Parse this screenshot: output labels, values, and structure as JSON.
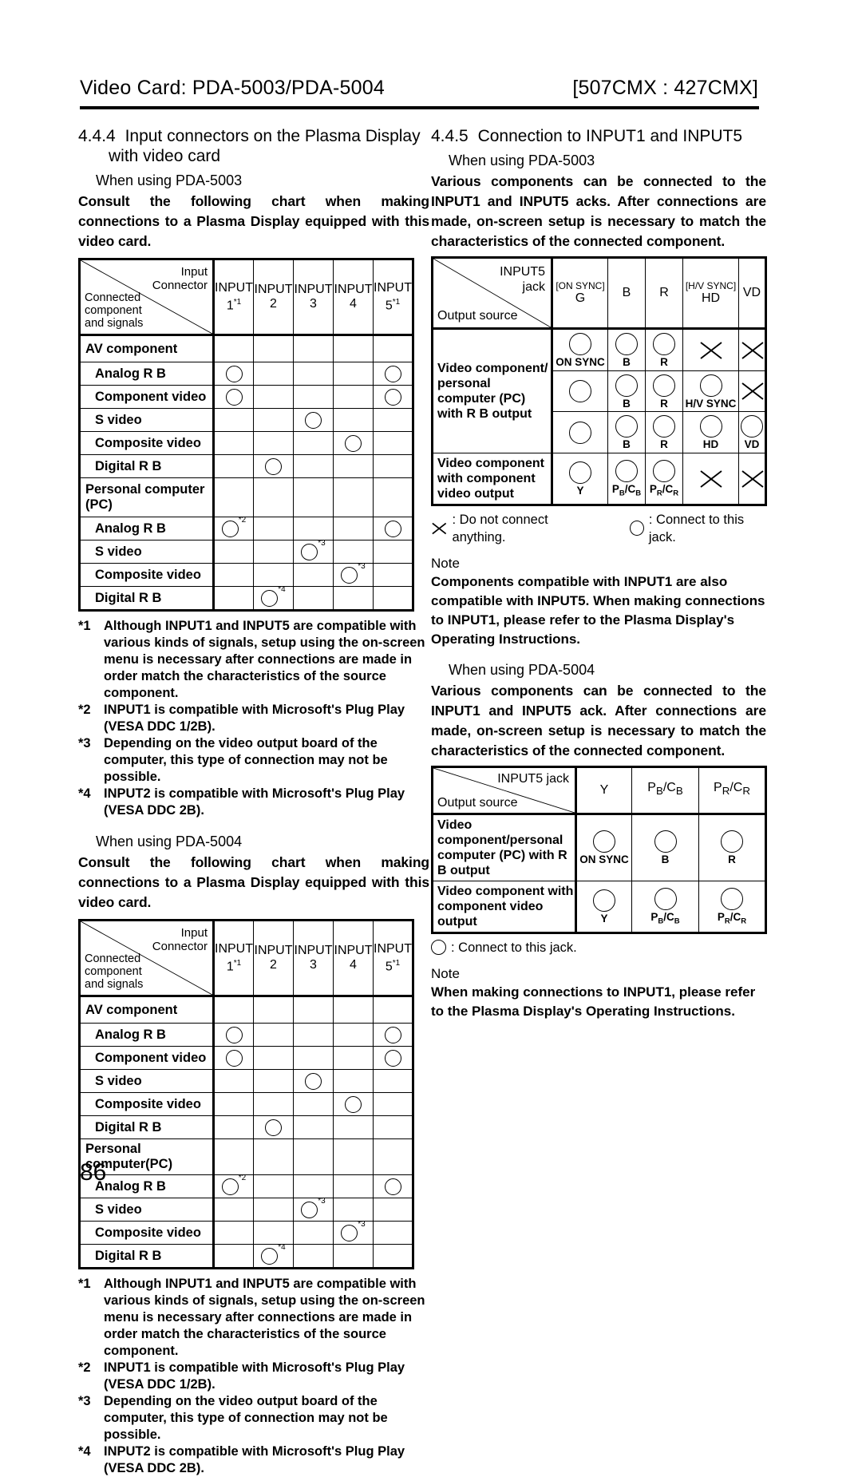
{
  "runhead": {
    "left": "Video Card: PDA-5003/PDA-5004",
    "right": "[507CMX : 427CMX]"
  },
  "page_number": "86",
  "left_column": {
    "section": {
      "number": "4.4.4",
      "title_line1": "Input connectors on the Plasma Display",
      "title_line2": "with video card"
    },
    "block_5003": {
      "subhead": "When using PDA-5003",
      "intro": "Consult the following chart when making connections to a Plasma Display equipped with this video card.",
      "table": {
        "corner_top_right": "Input\nConnector",
        "corner_bottom_left": "Connected\ncomponent\nand signals",
        "columns": [
          {
            "name": "INPUT",
            "num": "1",
            "note": "*1"
          },
          {
            "name": "INPUT",
            "num": "2",
            "note": ""
          },
          {
            "name": "INPUT",
            "num": "3",
            "note": ""
          },
          {
            "name": "INPUT",
            "num": "4",
            "note": ""
          },
          {
            "name": "INPUT",
            "num": "5",
            "note": "*1"
          }
        ],
        "rows": [
          {
            "type": "group",
            "label": "AV component",
            "marks": [
              "",
              "",
              "",
              "",
              ""
            ]
          },
          {
            "type": "sub",
            "label": "Analog R  B",
            "marks": [
              "o",
              "",
              "",
              "",
              "o"
            ]
          },
          {
            "type": "sub",
            "label": "Component video",
            "marks": [
              "o",
              "",
              "",
              "",
              "o"
            ]
          },
          {
            "type": "sub",
            "label": "S video",
            "marks": [
              "",
              "",
              "o",
              "",
              ""
            ]
          },
          {
            "type": "sub",
            "label": "Composite video",
            "marks": [
              "",
              "",
              "",
              "o",
              ""
            ]
          },
          {
            "type": "sub",
            "label": "Digital R  B",
            "marks": [
              "",
              "o",
              "",
              "",
              ""
            ]
          },
          {
            "type": "group",
            "label": "Personal computer\n(PC)",
            "marks": [
              "",
              "",
              "",
              "",
              ""
            ]
          },
          {
            "type": "sub",
            "label": "Analog R  B",
            "marks": [
              "o*2",
              "",
              "",
              "",
              "o"
            ]
          },
          {
            "type": "sub",
            "label": "S video",
            "marks": [
              "",
              "",
              "o*3",
              "",
              ""
            ]
          },
          {
            "type": "sub",
            "label": "Composite video",
            "marks": [
              "",
              "",
              "",
              "o*3",
              ""
            ]
          },
          {
            "type": "sub",
            "label": "Digital R  B",
            "marks": [
              "",
              "o*4",
              "",
              "",
              ""
            ]
          }
        ]
      },
      "footnotes": [
        {
          "key": "*1",
          "text": "Although INPUT1 and INPUT5 are compatible with various kinds of signals, setup using the on-screen menu is necessary after connections are made in order match the characteristics of the source component."
        },
        {
          "key": "*2",
          "text": "INPUT1 is compatible with Microsoft's Plug   Play (VESA DDC 1/2B)."
        },
        {
          "key": "*3",
          "text": "Depending on the video output board of the computer, this type of connection may not be possible."
        },
        {
          "key": "*4",
          "text": "INPUT2 is compatible with Microsoft's Plug   Play (VESA DDC 2B)."
        }
      ]
    },
    "block_5004": {
      "subhead": "When using PDA-5004",
      "intro": "Consult the following chart when making connections to a Plasma Display equipped with this video card.",
      "table": {
        "corner_top_right": "Input\nConnector",
        "corner_bottom_left": "Connected\ncomponent\nand signals",
        "columns": [
          {
            "name": "INPUT",
            "num": "1",
            "note": "*1"
          },
          {
            "name": "INPUT",
            "num": "2",
            "note": ""
          },
          {
            "name": "INPUT",
            "num": "3",
            "note": ""
          },
          {
            "name": "INPUT",
            "num": "4",
            "note": ""
          },
          {
            "name": "INPUT",
            "num": "5",
            "note": "*1"
          }
        ],
        "rows": [
          {
            "type": "group",
            "label": "AV component",
            "marks": [
              "",
              "",
              "",
              "",
              ""
            ]
          },
          {
            "type": "sub",
            "label": "Analog R  B",
            "marks": [
              "o",
              "",
              "",
              "",
              "o"
            ]
          },
          {
            "type": "sub",
            "label": "Component video",
            "marks": [
              "o",
              "",
              "",
              "",
              "o"
            ]
          },
          {
            "type": "sub",
            "label": "S video",
            "marks": [
              "",
              "",
              "o",
              "",
              ""
            ]
          },
          {
            "type": "sub",
            "label": "Composite video",
            "marks": [
              "",
              "",
              "",
              "o",
              ""
            ]
          },
          {
            "type": "sub",
            "label": "Digital R  B",
            "marks": [
              "",
              "o",
              "",
              "",
              ""
            ]
          },
          {
            "type": "group",
            "label": "Personal computer(PC)",
            "marks": [
              "",
              "",
              "",
              "",
              ""
            ]
          },
          {
            "type": "sub",
            "label": "Analog R  B",
            "marks": [
              "o*2",
              "",
              "",
              "",
              "o"
            ]
          },
          {
            "type": "sub",
            "label": "S video",
            "marks": [
              "",
              "",
              "o*3",
              "",
              ""
            ]
          },
          {
            "type": "sub",
            "label": "Composite video",
            "marks": [
              "",
              "",
              "",
              "o*3",
              ""
            ]
          },
          {
            "type": "sub",
            "label": "Digital R  B",
            "marks": [
              "",
              "o*4",
              "",
              "",
              ""
            ]
          }
        ]
      },
      "footnotes": [
        {
          "key": "*1",
          "text": "Although INPUT1 and INPUT5 are compatible with various kinds of signals, setup using the on-screen menu is necessary after connections are made in order match the characteristics of the source component."
        },
        {
          "key": "*2",
          "text": "INPUT1 is compatible with Microsoft's Plug   Play (VESA DDC 1/2B)."
        },
        {
          "key": "*3",
          "text": "Depending on the video output board of the computer, this type of connection may not be possible."
        },
        {
          "key": "*4",
          "text": "INPUT2 is compatible with Microsoft's Plug   Play (VESA DDC 2B)."
        }
      ]
    }
  },
  "right_column": {
    "section": {
      "number": "4.4.5",
      "title": "Connection to INPUT1 and INPUT5"
    },
    "block_5003": {
      "subhead": "When using PDA-5003",
      "intro": "Various components can be connected to the INPUT1 and INPUT5  acks. After connections are made, on-screen setup is necessary to match the characteristics of the connected component.",
      "table": {
        "corner_top_right": "INPUT5\njack",
        "corner_bottom_left": "Output source",
        "columns": [
          {
            "bracket": "[ON SYNC]",
            "label": "G"
          },
          {
            "bracket": "",
            "label": "B"
          },
          {
            "bracket": "",
            "label": "R"
          },
          {
            "bracket": "[H/V SYNC]",
            "label": "HD"
          },
          {
            "bracket": "",
            "label": "VD"
          }
        ],
        "rows": [
          {
            "source": "Video component/\npersonal\ncomputer (PC)\nwith R  B output",
            "source_rowspan": 3,
            "cells": [
              {
                "mark": "o",
                "label": "ON SYNC"
              },
              {
                "mark": "o",
                "label": "B"
              },
              {
                "mark": "o",
                "label": "R"
              },
              {
                "mark": "x",
                "label": ""
              },
              {
                "mark": "x",
                "label": ""
              }
            ]
          },
          {
            "source": "",
            "cells": [
              {
                "mark": "o",
                "label": ""
              },
              {
                "mark": "o",
                "label": "B"
              },
              {
                "mark": "o",
                "label": "R"
              },
              {
                "mark": "o",
                "label": "H/V SYNC"
              },
              {
                "mark": "x",
                "label": ""
              }
            ]
          },
          {
            "source": "",
            "cells": [
              {
                "mark": "o",
                "label": ""
              },
              {
                "mark": "o",
                "label": "B"
              },
              {
                "mark": "o",
                "label": "R"
              },
              {
                "mark": "o",
                "label": "HD"
              },
              {
                "mark": "o",
                "label": "VD"
              }
            ]
          },
          {
            "source": "Video component\nwith component\nvideo output",
            "source_rowspan": 1,
            "cells": [
              {
                "mark": "o",
                "label": "Y"
              },
              {
                "mark": "o",
                "label": "PB/CB"
              },
              {
                "mark": "o",
                "label": "PR/CR"
              },
              {
                "mark": "x",
                "label": ""
              },
              {
                "mark": "x",
                "label": ""
              }
            ]
          }
        ]
      },
      "legend_x": ": Do not connect anything.",
      "legend_o": ": Connect to this jack.",
      "note_label": "Note",
      "note_text": "Components compatible with INPUT1 are also compatible with INPUT5. When making connections to INPUT1, please refer to the Plasma Display's Operating Instructions."
    },
    "block_5004": {
      "subhead": "When using PDA-5004",
      "intro": "Various components can be connected to the INPUT1 and INPUT5  ack. After connections are made, on-screen setup is necessary to match the characteristics of the connected component.",
      "table": {
        "corner_top_right": "INPUT5 jack",
        "corner_bottom_left": "Output source",
        "columns": [
          {
            "label": "Y"
          },
          {
            "label": "PB/CB"
          },
          {
            "label": "PR/CR"
          }
        ],
        "rows": [
          {
            "source": "Video component/personal computer (PC) with R  B output",
            "cells": [
              {
                "mark": "o",
                "label": "ON SYNC"
              },
              {
                "mark": "o",
                "label": "B"
              },
              {
                "mark": "o",
                "label": "R"
              }
            ]
          },
          {
            "source": "Video component with component video output",
            "cells": [
              {
                "mark": "o",
                "label": "Y"
              },
              {
                "mark": "o",
                "label": "PB/CB"
              },
              {
                "mark": "o",
                "label": "PR/CR"
              }
            ]
          }
        ]
      },
      "legend_o": ": Connect to this jack.",
      "note_label": "Note",
      "note_text": "When making connections to INPUT1, please refer to the Plasma Display's Operating Instructions."
    }
  }
}
